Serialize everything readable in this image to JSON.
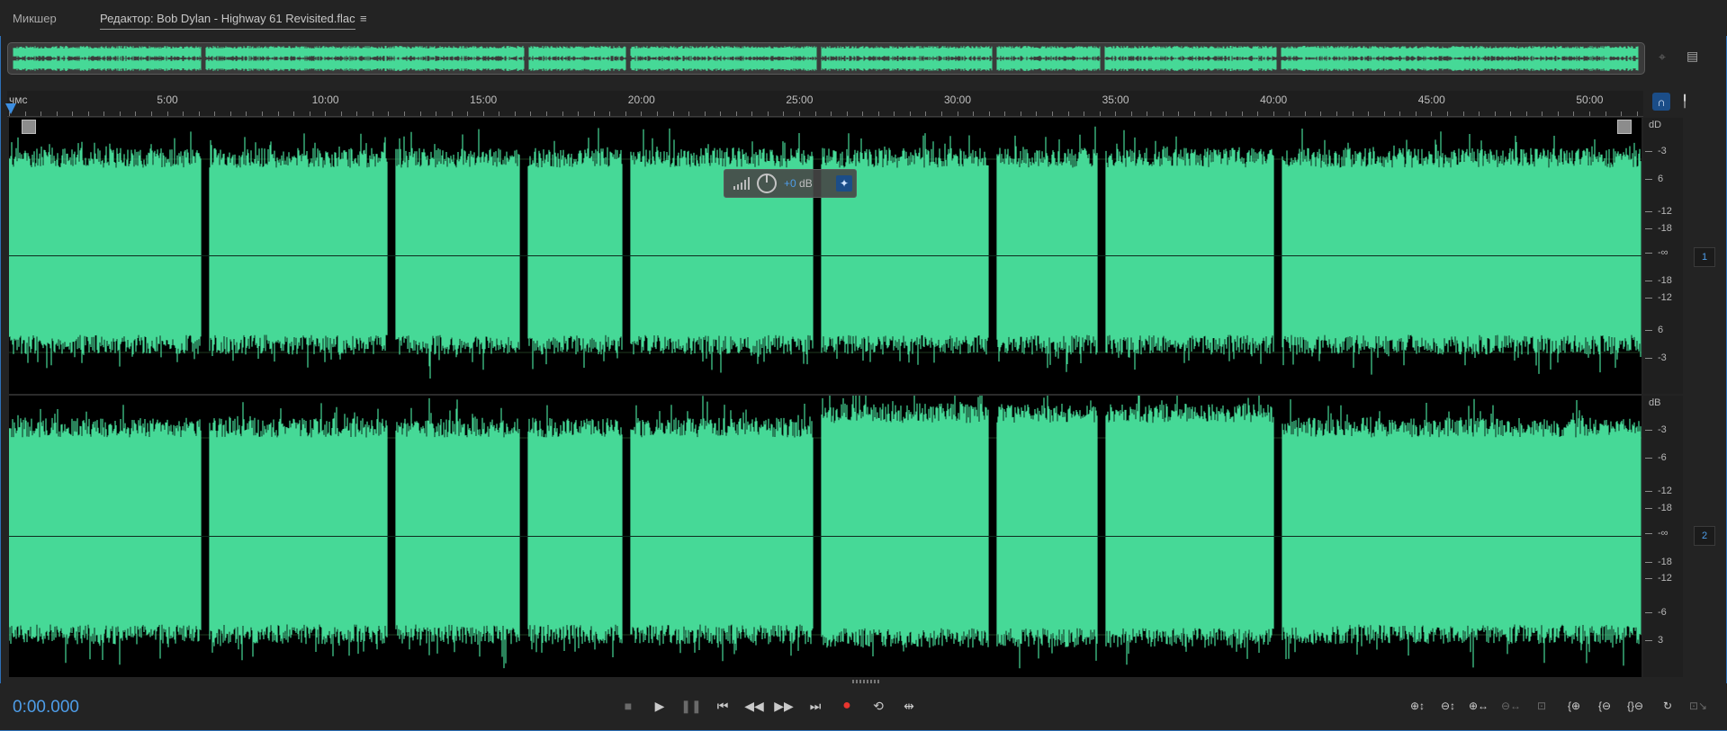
{
  "tabs": {
    "mixer": "Микшер",
    "editor": "Редактор: Bob Dylan - Highway 61 Revisited.flac",
    "menu_icon": "hamburger-menu-icon"
  },
  "ruler": {
    "unit": "чмс",
    "labels": [
      "5:00",
      "10:00",
      "15:00",
      "20:00",
      "25:00",
      "30:00",
      "35:00",
      "40:00",
      "45:00",
      "50:00"
    ]
  },
  "channels": [
    {
      "number": "1",
      "db_header": "dD",
      "scale": [
        "-3",
        "6",
        "-12",
        "-18",
        "-∞",
        "-18",
        "-12",
        "6",
        "-3"
      ]
    },
    {
      "number": "2",
      "db_header": "dB",
      "scale": [
        "-3",
        "-6",
        "-12",
        "-18",
        "-∞",
        "-18",
        "-12",
        "-6",
        "3"
      ]
    }
  ],
  "hud": {
    "value": "+0",
    "unit": "dB",
    "pin_icon": "pin-icon"
  },
  "transport": {
    "time": "0:00.000",
    "buttons": [
      "stop-icon",
      "play-icon",
      "pause-icon",
      "go-to-start-icon",
      "rewind-icon",
      "fast-forward-icon",
      "go-to-end-icon",
      "record-icon",
      "loop-icon",
      "skip-selection-icon"
    ]
  },
  "zoom": {
    "buttons": [
      "zoom-in-amplitude-icon",
      "zoom-out-amplitude-icon",
      "zoom-in-time-icon",
      "zoom-out-time-icon",
      "zoom-to-selection-icon",
      "zoom-in-point-icon",
      "zoom-out-point-icon",
      "zoom-full-icon",
      "zoom-reset-icon",
      "zoom-history-icon"
    ]
  },
  "colors": {
    "waveform": "#46d997",
    "accent": "#4e9de8",
    "record": "#e8352e"
  }
}
